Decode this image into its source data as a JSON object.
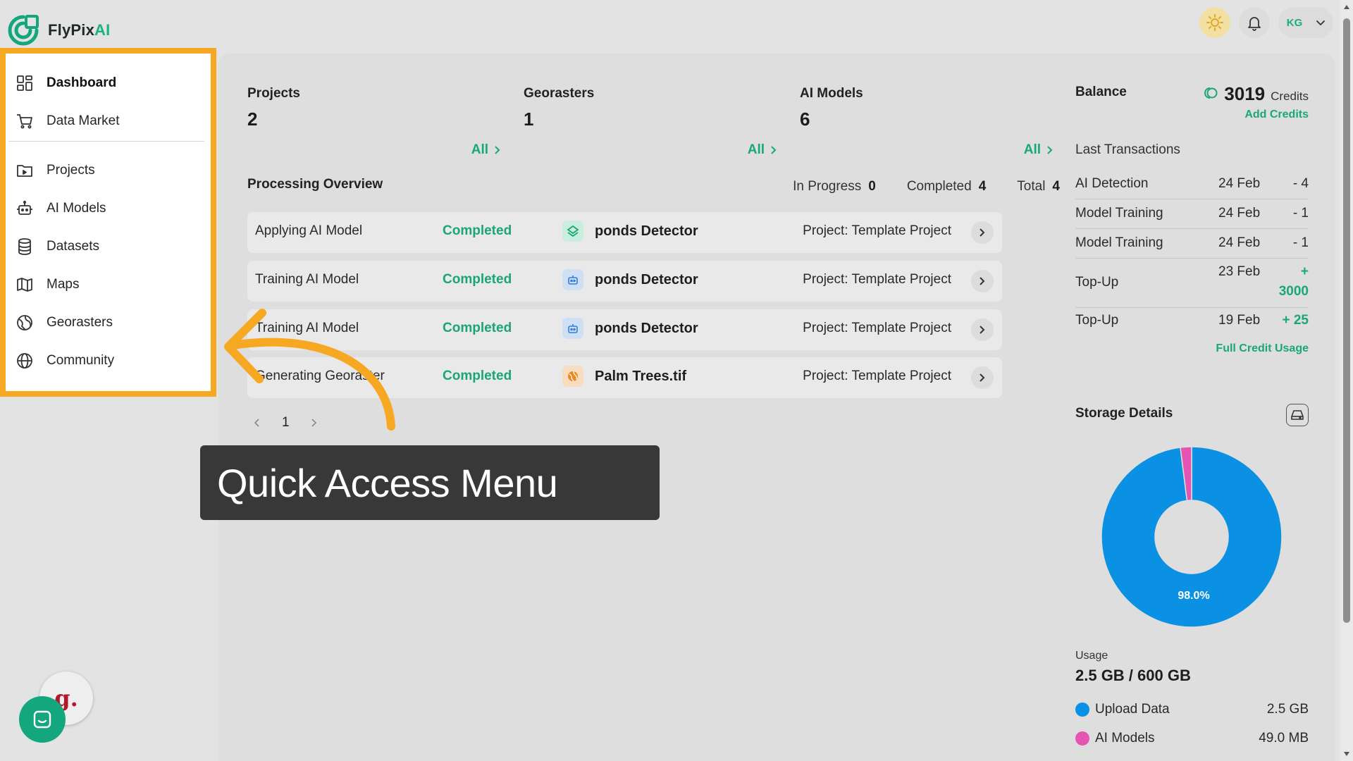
{
  "app": {
    "name_main": "FlyPix",
    "name_accent": "AI",
    "user_initials": "KG"
  },
  "colors": {
    "accent": "#19a874",
    "highlight": "#f7a823",
    "storage_upload": "#0a91e3",
    "storage_models": "#e454b0"
  },
  "icons": {
    "theme": "sun-icon",
    "notifications": "bell-icon",
    "menu": "chevron-down-icon"
  },
  "sidebar": {
    "items": [
      {
        "label": "Dashboard",
        "icon": "dashboard-icon"
      },
      {
        "label": "Data Market",
        "icon": "cart-icon"
      },
      {
        "label": "Projects",
        "icon": "folder-icon"
      },
      {
        "label": "AI Models",
        "icon": "robot-icon"
      },
      {
        "label": "Datasets",
        "icon": "database-icon"
      },
      {
        "label": "Maps",
        "icon": "map-icon"
      },
      {
        "label": "Georasters",
        "icon": "globe-grid-icon"
      },
      {
        "label": "Community",
        "icon": "globe-icon"
      }
    ]
  },
  "stats": {
    "projects": {
      "label": "Projects",
      "value": "2",
      "all": "All"
    },
    "georasters": {
      "label": "Georasters",
      "value": "1",
      "all": "All"
    },
    "models": {
      "label": "AI Models",
      "value": "6",
      "all": "All"
    }
  },
  "processing": {
    "title": "Processing Overview",
    "in_progress_label": "In Progress",
    "in_progress_value": "0",
    "completed_label": "Completed",
    "completed_value": "4",
    "total_label": "Total",
    "total_value": "4",
    "rows": [
      {
        "task": "Applying AI Model",
        "status": "Completed",
        "name": "ponds Detector",
        "project": "Project: Template Project",
        "icon": "layers-icon"
      },
      {
        "task": "Training AI Model",
        "status": "Completed",
        "name": "ponds Detector",
        "project": "Project: Template Project",
        "icon": "robot-icon"
      },
      {
        "task": "Training AI Model",
        "status": "Completed",
        "name": "ponds Detector",
        "project": "Project: Template Project",
        "icon": "robot-icon"
      },
      {
        "task": "Generating Georaster",
        "status": "Completed",
        "name": "Palm Trees.tif",
        "project": "Project: Template Project",
        "icon": "globe-icon"
      }
    ],
    "page": "1"
  },
  "balance": {
    "label": "Balance",
    "value": "3019",
    "unit": "Credits",
    "add": "Add Credits"
  },
  "transactions": {
    "title": "Last Transactions",
    "rows": [
      {
        "name": "AI Detection",
        "date": "24 Feb",
        "amount": "- 4"
      },
      {
        "name": "Model Training",
        "date": "24 Feb",
        "amount": "- 1"
      },
      {
        "name": "Model Training",
        "date": "24 Feb",
        "amount": "- 1"
      },
      {
        "name": "Top-Up",
        "date": "23 Feb",
        "amount_sign": "+",
        "amount_value": "3000"
      },
      {
        "name": "Top-Up",
        "date": "19 Feb",
        "amount": "+ 25"
      }
    ],
    "full_usage": "Full Credit Usage"
  },
  "storage": {
    "title": "Storage Details",
    "donut_label": "98.0%",
    "usage_label": "Usage",
    "usage_value": "2.5 GB / 600 GB",
    "legend": [
      {
        "name": "Upload Data",
        "size": "2.5 GB"
      },
      {
        "name": "AI Models",
        "size": "49.0 MB"
      }
    ]
  },
  "chart_data": {
    "type": "pie",
    "categories": [
      "Upload Data",
      "AI Models"
    ],
    "values": [
      98.0,
      2.0
    ],
    "data_labels": [
      "98.0%",
      ""
    ]
  },
  "annotation": {
    "callout": "Quick Access Menu"
  }
}
